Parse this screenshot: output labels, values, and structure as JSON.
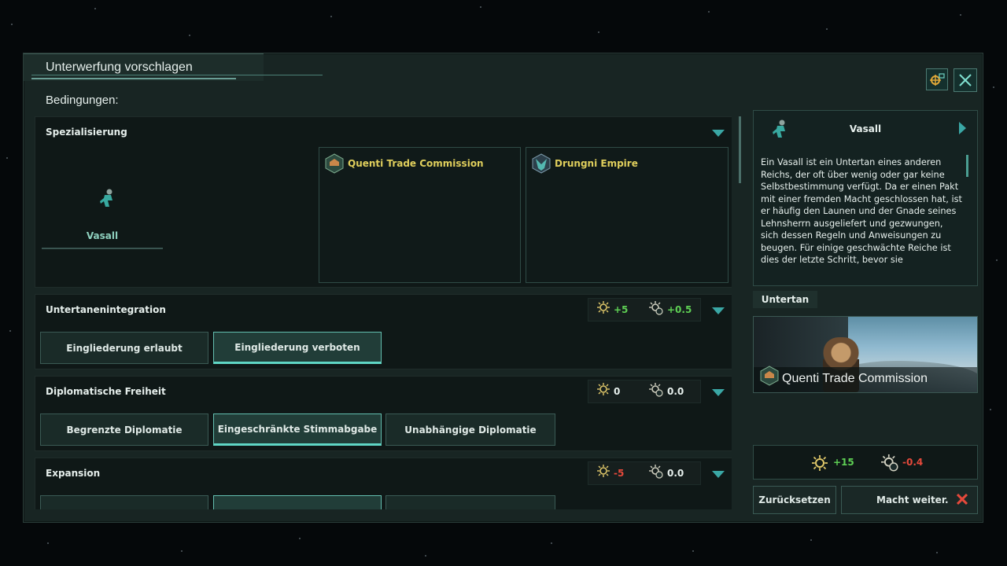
{
  "window": {
    "title": "Unterwerfung vorschlagen",
    "conditions_label": "Bedingungen:"
  },
  "header_buttons": {
    "camera": "camera-icon",
    "close": "close-icon"
  },
  "specialization": {
    "title": "Spezialisierung",
    "current": "Vasall",
    "empires": [
      "Quenti Trade Commission",
      "Drungni Empire"
    ]
  },
  "sections": [
    {
      "title": "Untertanenintegration",
      "effects": [
        {
          "value": "+5",
          "tone": "pos"
        },
        {
          "value": "+0.5",
          "tone": "pos"
        }
      ],
      "options": [
        {
          "label": "Eingliederung erlaubt",
          "selected": false
        },
        {
          "label": "Eingliederung verboten",
          "selected": true
        }
      ]
    },
    {
      "title": "Diplomatische Freiheit",
      "effects": [
        {
          "value": "0",
          "tone": "neu"
        },
        {
          "value": "0.0",
          "tone": "neu"
        }
      ],
      "options": [
        {
          "label": "Begrenzte Diplomatie",
          "selected": false
        },
        {
          "label": "Eingeschränkte Stimmabgabe",
          "selected": true
        },
        {
          "label": "Unabhängige Diplomatie",
          "selected": false
        }
      ]
    },
    {
      "title": "Expansion",
      "effects": [
        {
          "value": "-5",
          "tone": "neg"
        },
        {
          "value": "0.0",
          "tone": "neu"
        }
      ]
    }
  ],
  "info": {
    "title": "Vasall",
    "text": "Ein Vasall ist ein Untertan eines anderen Reichs, der oft über wenig oder gar keine Selbstbestimmung verfügt. Da er einen Pakt mit einer fremden Macht geschlossen hat, ist er häufig den Launen und der Gnade seines Lehnsherrn ausgeliefert und gezwungen, sich dessen Regeln und Anweisungen zu beugen. Für einige geschwächte Reiche ist dies der letzte Schritt, bevor sie"
  },
  "subject": {
    "tab": "Untertan",
    "name": "Quenti Trade Commission"
  },
  "totals": [
    {
      "value": "+15",
      "tone": "pos"
    },
    {
      "value": "-0.4",
      "tone": "neg"
    }
  ],
  "footer": {
    "reset": "Zurücksetzen",
    "confirm": "Macht weiter."
  },
  "colors": {
    "accent": "#3aa7a5",
    "positive": "#5ecf54",
    "negative": "#e5493b",
    "empire_name": "#e0cf5c"
  }
}
